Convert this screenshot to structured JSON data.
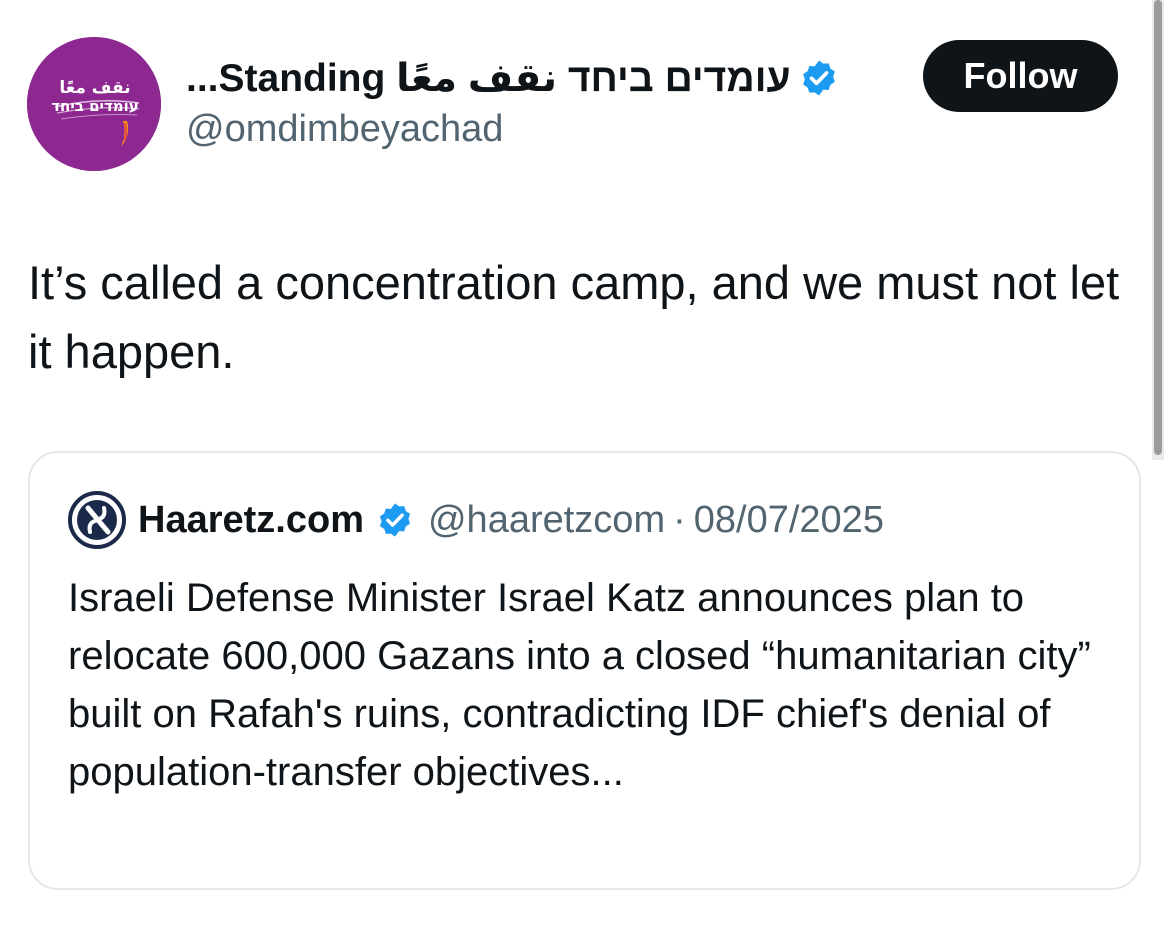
{
  "author": {
    "display_name": "עומדים ביחד نقف معًا Standing...",
    "handle": "@omdimbeyachad",
    "avatar_lines": [
      "نقف معًا",
      "עומדים ביחד"
    ],
    "avatar_color": "#8e2891",
    "verified_icon": "verified-badge-icon"
  },
  "follow_button": {
    "label": "Follow"
  },
  "tweet": {
    "text": "It’s called a concentration camp, and we must not let it happen."
  },
  "quoted_tweet": {
    "logo_icon": "haaretz-logo-icon",
    "display_name": "Haaretz.com",
    "handle": "@haaretzcom",
    "separator": "·",
    "date": "08/07/2025",
    "text": "Israeli Defense Minister Israel Katz announces plan to relocate 600,000 Gazans into a closed “humanitarian city” built on Rafah's ruins, contradicting IDF chief's denial of population-transfer objectives..."
  },
  "colors": {
    "verified": "#1d9bf0",
    "text_primary": "#0f1419",
    "text_secondary": "#536471",
    "border": "#e4e8eb"
  }
}
